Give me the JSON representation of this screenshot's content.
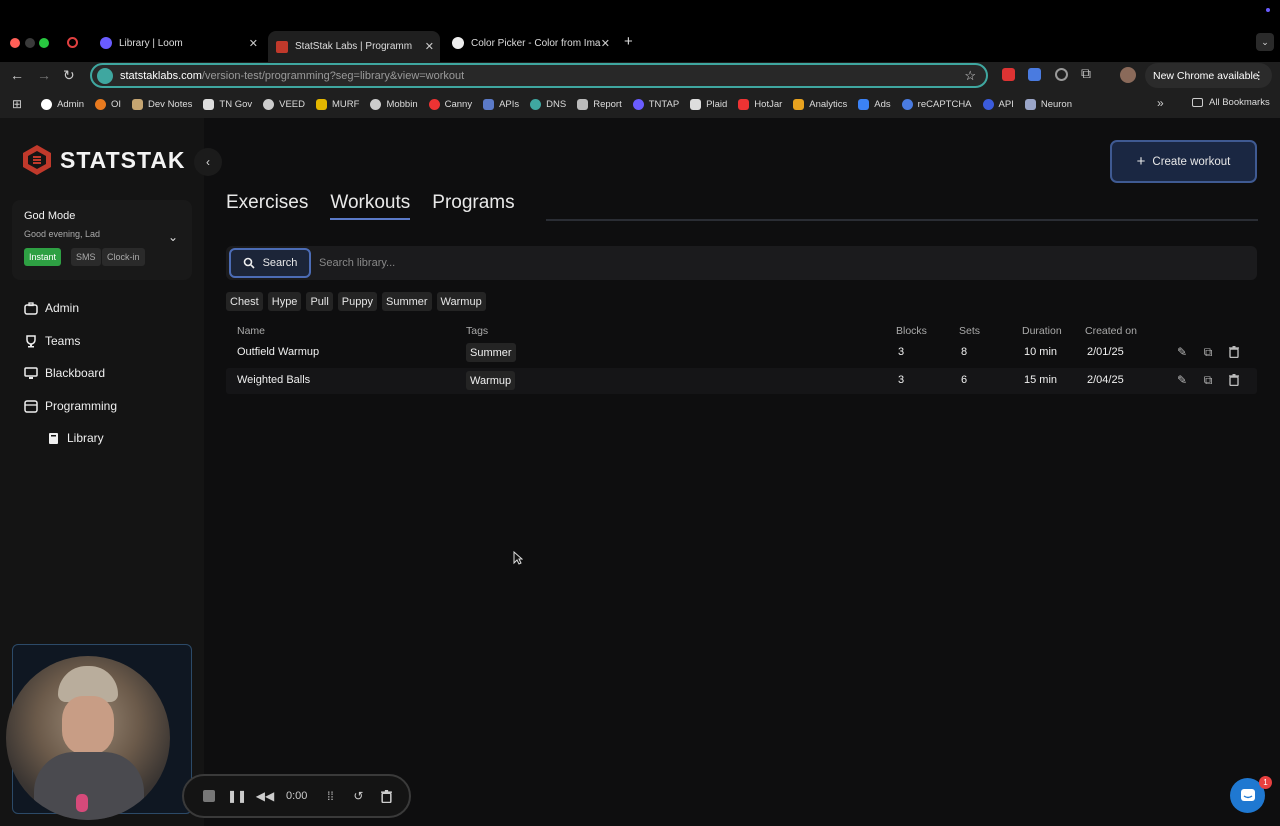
{
  "browser": {
    "tabs": [
      {
        "title": "Library | Loom"
      },
      {
        "title": "StatStak Labs | Programm"
      },
      {
        "title": "Color Picker - Color from Ima"
      }
    ],
    "url_host": "statstaklabs.com",
    "url_path": "/version-test/programming?seg=library&view=workout",
    "update_label": "New Chrome available",
    "bookmarks": [
      "Admin",
      "OI",
      "Dev Notes",
      "TN Gov",
      "VEED",
      "MURF",
      "Mobbin",
      "Canny",
      "APIs",
      "DNS",
      "Report",
      "TNTAP",
      "Plaid",
      "HotJar",
      "Analytics",
      "Ads",
      "reCAPTCHA",
      "API",
      "Neuron"
    ],
    "all_bookmarks": "All Bookmarks"
  },
  "sidebar": {
    "brand": "STATSTAK",
    "user": {
      "name": "God Mode",
      "greeting": "Good evening, Lad",
      "pills": [
        "Instant",
        "SMS",
        "Clock-in"
      ]
    },
    "nav": [
      {
        "label": "Admin"
      },
      {
        "label": "Teams"
      },
      {
        "label": "Blackboard"
      },
      {
        "label": "Programming"
      },
      {
        "label": "Library"
      }
    ]
  },
  "main": {
    "tabs": [
      "Exercises",
      "Workouts",
      "Programs"
    ],
    "active_tab": "Workouts",
    "create_button": "Create workout",
    "search": {
      "button": "Search",
      "placeholder": "Search library..."
    },
    "filter_tags": [
      "Chest",
      "Hype",
      "Pull",
      "Puppy",
      "Summer",
      "Warmup"
    ],
    "table": {
      "columns": [
        "Name",
        "Tags",
        "Blocks",
        "Sets",
        "Duration",
        "Created on"
      ],
      "rows": [
        {
          "name": "Outfield Warmup",
          "tag": "Summer",
          "blocks": "3",
          "sets": "8",
          "duration": "10 min",
          "created": "2/01/25"
        },
        {
          "name": "Weighted Balls",
          "tag": "Warmup",
          "blocks": "3",
          "sets": "6",
          "duration": "15 min",
          "created": "2/04/25"
        }
      ]
    }
  },
  "recorder": {
    "time": "0:00"
  },
  "intercom": {
    "badge": "1"
  },
  "colors": {
    "accent": "#4c6cb5",
    "instant_pill": "#2ea043",
    "omnibox_border": "#3fa7a0"
  }
}
